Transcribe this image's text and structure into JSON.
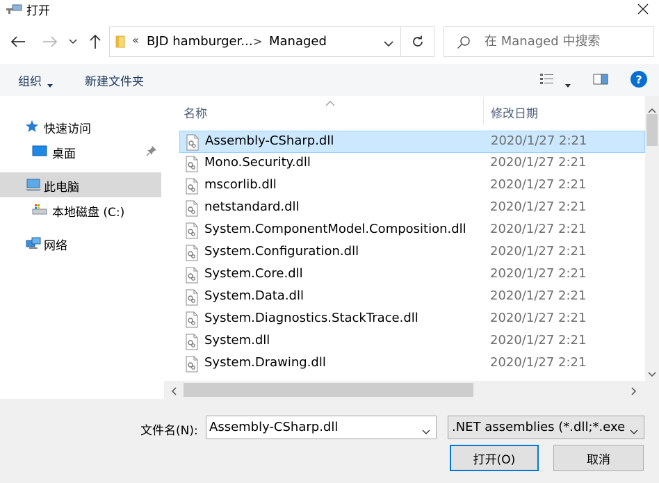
{
  "window": {
    "title": "打开"
  },
  "address": {
    "chevron": "«",
    "crumbs": [
      "BJD hamburger...",
      "Managed"
    ],
    "separator": ">"
  },
  "search": {
    "placeholder": "在 Managed 中搜索"
  },
  "toolbar": {
    "organize_label": "组织",
    "new_folder_label": "新建文件夹",
    "help_label": "?"
  },
  "sidebar": {
    "items": [
      {
        "label": "快速访问",
        "icon": "star-icon"
      },
      {
        "label": "桌面",
        "icon": "desktop-icon"
      },
      {
        "label": "此电脑",
        "icon": "computer-icon"
      },
      {
        "label": "本地磁盘 (C:)",
        "icon": "drive-icon"
      },
      {
        "label": "网络",
        "icon": "network-icon"
      }
    ]
  },
  "filelist": {
    "columns": {
      "name": "名称",
      "date": "修改日期"
    },
    "rows": [
      {
        "name": "Assembly-CSharp.dll",
        "date": "2020/1/27 2:21"
      },
      {
        "name": "Mono.Security.dll",
        "date": "2020/1/27 2:21"
      },
      {
        "name": "mscorlib.dll",
        "date": "2020/1/27 2:21"
      },
      {
        "name": "netstandard.dll",
        "date": "2020/1/27 2:21"
      },
      {
        "name": "System.ComponentModel.Composition.dll",
        "date": "2020/1/27 2:21"
      },
      {
        "name": "System.Configuration.dll",
        "date": "2020/1/27 2:21"
      },
      {
        "name": "System.Core.dll",
        "date": "2020/1/27 2:21"
      },
      {
        "name": "System.Data.dll",
        "date": "2020/1/27 2:21"
      },
      {
        "name": "System.Diagnostics.StackTrace.dll",
        "date": "2020/1/27 2:21"
      },
      {
        "name": "System.dll",
        "date": "2020/1/27 2:21"
      },
      {
        "name": "System.Drawing.dll",
        "date": "2020/1/27 2:21"
      }
    ],
    "selected_row": "Assembly-CSharp.dll"
  },
  "bottom": {
    "filename_label": "文件名(N):",
    "filename_value": "Assembly-CSharp.dll",
    "filter_value": ".NET assemblies (*.dll;*.exe;*.w",
    "open_label": "打开(O)",
    "cancel_label": "取消"
  },
  "colors": {
    "accent": "#0078d7",
    "selection": "#cce8ff",
    "help": "#0a6ed1"
  }
}
